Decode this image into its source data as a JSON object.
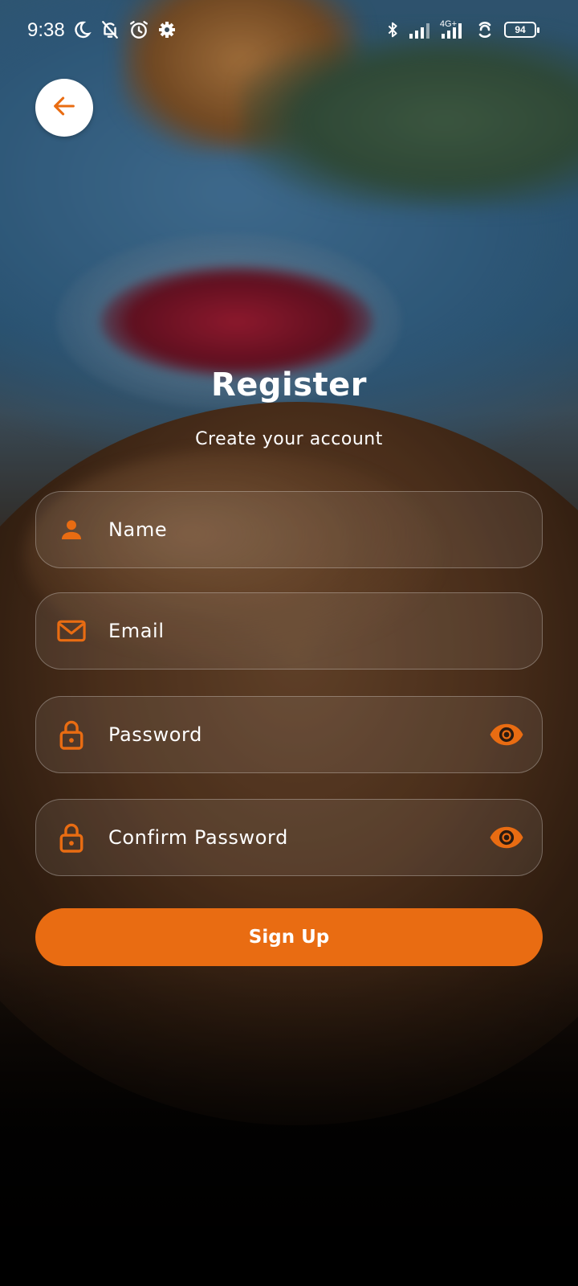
{
  "status_bar": {
    "time": "9:38",
    "network": "4G+",
    "battery": "94",
    "icons_left": [
      "moon-icon",
      "bell-off-icon",
      "alarm-icon",
      "gear-icon"
    ],
    "icons_right": [
      "bluetooth-icon",
      "signal-icon",
      "signal-4g-icon",
      "hotspot-icon",
      "battery-icon"
    ]
  },
  "header": {
    "back_icon": "arrow-left-icon"
  },
  "main": {
    "title": "Register",
    "subtitle": "Create your account"
  },
  "form": {
    "name": {
      "placeholder": "Name",
      "value": "",
      "icon": "person-icon"
    },
    "email": {
      "placeholder": "Email",
      "value": "",
      "icon": "mail-icon"
    },
    "password": {
      "placeholder": "Password",
      "value": "",
      "icon": "lock-icon",
      "toggle_icon": "eye-icon"
    },
    "confirm_password": {
      "placeholder": "Confirm Password",
      "value": "",
      "icon": "lock-icon",
      "toggle_icon": "eye-icon"
    },
    "submit_label": "Sign Up"
  },
  "colors": {
    "accent": "#e96c12",
    "text": "#ffffff",
    "field_border": "rgba(255,255,255,0.28)"
  }
}
